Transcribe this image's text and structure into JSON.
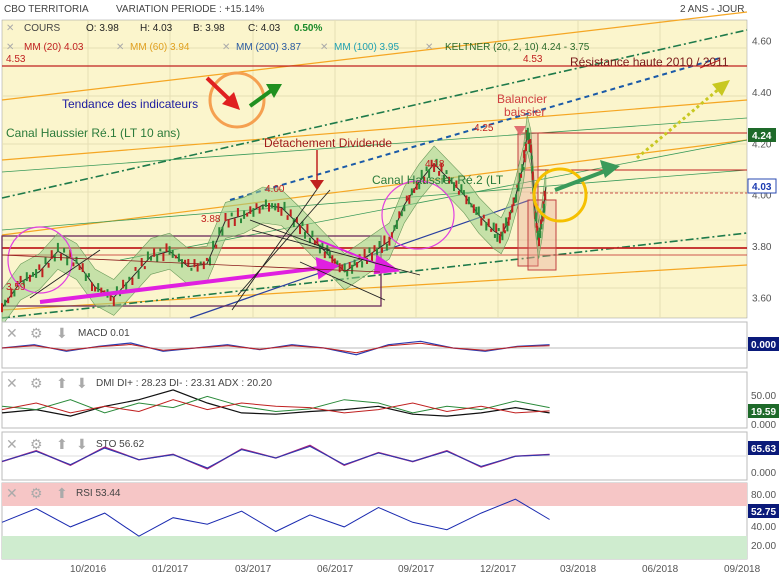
{
  "header": {
    "name": "CBO TERRITORIA",
    "variation": "VARIATION PERIODE : +15.14%",
    "period": "2 ANS - JOUR"
  },
  "quote": {
    "label": "COURS",
    "o": "O: 3.98",
    "h": "H: 4.03",
    "b": "B: 3.98",
    "c": "C: 4.03",
    "chg": "0.50%"
  },
  "indicators": {
    "mm20": "MM (20)  4.03",
    "mm60": "MM (60)  3.94",
    "mm200": "MM (200)  3.87",
    "mm100": "MM (100)  3.95",
    "keltner": "KELTNER (20, 2, 10)  4.24 - 3.75"
  },
  "annotations": {
    "trend": "Tendance des indicateurs",
    "canal1": "Canal Haussier Ré.1 (LT 10 ans)",
    "dividend": "Détachement Dividende",
    "canal2": "Canal Haussier Ré.2 (LT",
    "balancier": "Balancier",
    "baissier": "baissier",
    "resistance": "Résistance haute 2010 / 2011",
    "v453a": "4.53",
    "v453b": "4.53",
    "v425": "4.25",
    "v418": "4.18",
    "v400": "4.00",
    "v388": "3.88",
    "v359": "3.59"
  },
  "panels": {
    "macd": {
      "label": "MACD  0.01",
      "value": "0.000"
    },
    "dmi": {
      "label": "DMI  DI+ : 28.23  DI- : 23.31  ADX : 20.20",
      "value": "19.59"
    },
    "sto": {
      "label": "STO  56.62",
      "value": "65.63"
    },
    "rsi": {
      "label": "RSI  53.44",
      "value": "52.75"
    }
  },
  "price_badges": {
    "high": "4.24",
    "last": "4.03"
  },
  "chart_data": {
    "type": "line",
    "title": "CBO TERRITORIA",
    "x_ticks": [
      "10/2016",
      "01/2017",
      "03/2017",
      "06/2017",
      "09/2017",
      "12/2017",
      "03/2018",
      "06/2018",
      "09/2018"
    ],
    "price_axis": {
      "ticks": [
        "3.60",
        "3.80",
        "4.00",
        "4.20",
        "4.40",
        "4.60"
      ],
      "ylim": [
        3.52,
        4.68
      ]
    },
    "lower_axes": {
      "dmi": [
        "50.00",
        "0.000"
      ],
      "sto": [
        "0.000"
      ],
      "rsi": [
        "80.00",
        "40.00",
        "20.00"
      ]
    },
    "series": [
      {
        "name": "COURS",
        "x": [
          0,
          0.025,
          0.05,
          0.075,
          0.1,
          0.125,
          0.15,
          0.175,
          0.2,
          0.225,
          0.25,
          0.275,
          0.3,
          0.325,
          0.35,
          0.375,
          0.4,
          0.42,
          0.44,
          0.46,
          0.48,
          0.5,
          0.52,
          0.54,
          0.56,
          0.58,
          0.6,
          0.62,
          0.64,
          0.66,
          0.67,
          0.68,
          0.69,
          0.7,
          0.705,
          0.71,
          0.715,
          0.72,
          0.725,
          0.73
        ],
        "values": [
          3.56,
          3.66,
          3.7,
          3.78,
          3.74,
          3.64,
          3.6,
          3.68,
          3.76,
          3.78,
          3.72,
          3.73,
          3.9,
          3.92,
          3.96,
          3.95,
          3.88,
          3.82,
          3.76,
          3.7,
          3.74,
          3.78,
          3.82,
          3.96,
          4.05,
          4.12,
          4.06,
          4.0,
          3.92,
          3.86,
          3.84,
          3.9,
          4.0,
          4.12,
          4.24,
          4.18,
          3.95,
          3.82,
          3.9,
          4.03
        ]
      }
    ],
    "panels_values": {
      "macd": [
        0,
        0.01,
        -0.01,
        0.005,
        0.015,
        -0.01,
        0.0,
        0.01,
        -0.005,
        0.01,
        0.0,
        -0.02,
        0.01,
        0.02,
        0.0,
        -0.01,
        0.005,
        0.01
      ],
      "dmi_plus": [
        30,
        25,
        40,
        20,
        35,
        28,
        45,
        30,
        22,
        26,
        40,
        35,
        20,
        30,
        25,
        38,
        28
      ],
      "dmi_minus": [
        25,
        35,
        20,
        30,
        22,
        40,
        25,
        35,
        30,
        28,
        20,
        25,
        35,
        22,
        30,
        20,
        23
      ],
      "adx": [
        20,
        25,
        15,
        30,
        40,
        55,
        35,
        20,
        18,
        22,
        25,
        30,
        18,
        15,
        20,
        28,
        20
      ],
      "sto": [
        40,
        70,
        30,
        80,
        45,
        60,
        20,
        75,
        50,
        85,
        30,
        65,
        40,
        70,
        25,
        55,
        60
      ],
      "rsi": [
        50,
        65,
        45,
        60,
        35,
        55,
        48,
        62,
        40,
        58,
        45,
        66,
        50,
        42,
        60,
        75,
        53
      ]
    }
  }
}
